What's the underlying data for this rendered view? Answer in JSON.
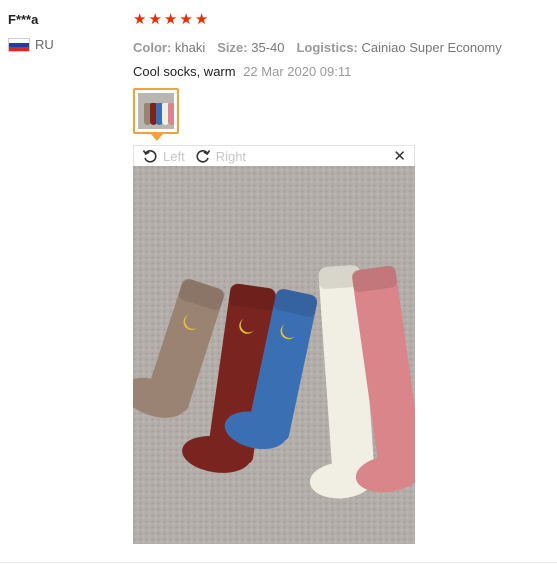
{
  "reviewer": {
    "name": "F***a",
    "country_code": "RU",
    "flag": [
      "#ffffff",
      "#1c3fa8",
      "#d52b1e"
    ]
  },
  "rating": {
    "stars": 5,
    "star_glyph": "★",
    "color": "#e62e04"
  },
  "attributes": [
    {
      "label": "Color:",
      "value": "khaki"
    },
    {
      "label": "Size:",
      "value": "35-40"
    },
    {
      "label": "Logistics:",
      "value": "Cainiao Super Economy"
    }
  ],
  "review": {
    "text": "Cool socks, warm",
    "date": "22 Mar 2020 09:11"
  },
  "viewer": {
    "rotate_left_label": "Left",
    "rotate_right_label": "Right",
    "close_glyph": "✕"
  },
  "photo": {
    "subject": "five socks on carpet",
    "socks": [
      {
        "color": "#9a8373"
      },
      {
        "color": "#7a2420"
      },
      {
        "color": "#3a6fb3"
      },
      {
        "color": "#f1efe3"
      },
      {
        "color": "#d9858a"
      }
    ]
  },
  "accent_color": "#f4a137"
}
